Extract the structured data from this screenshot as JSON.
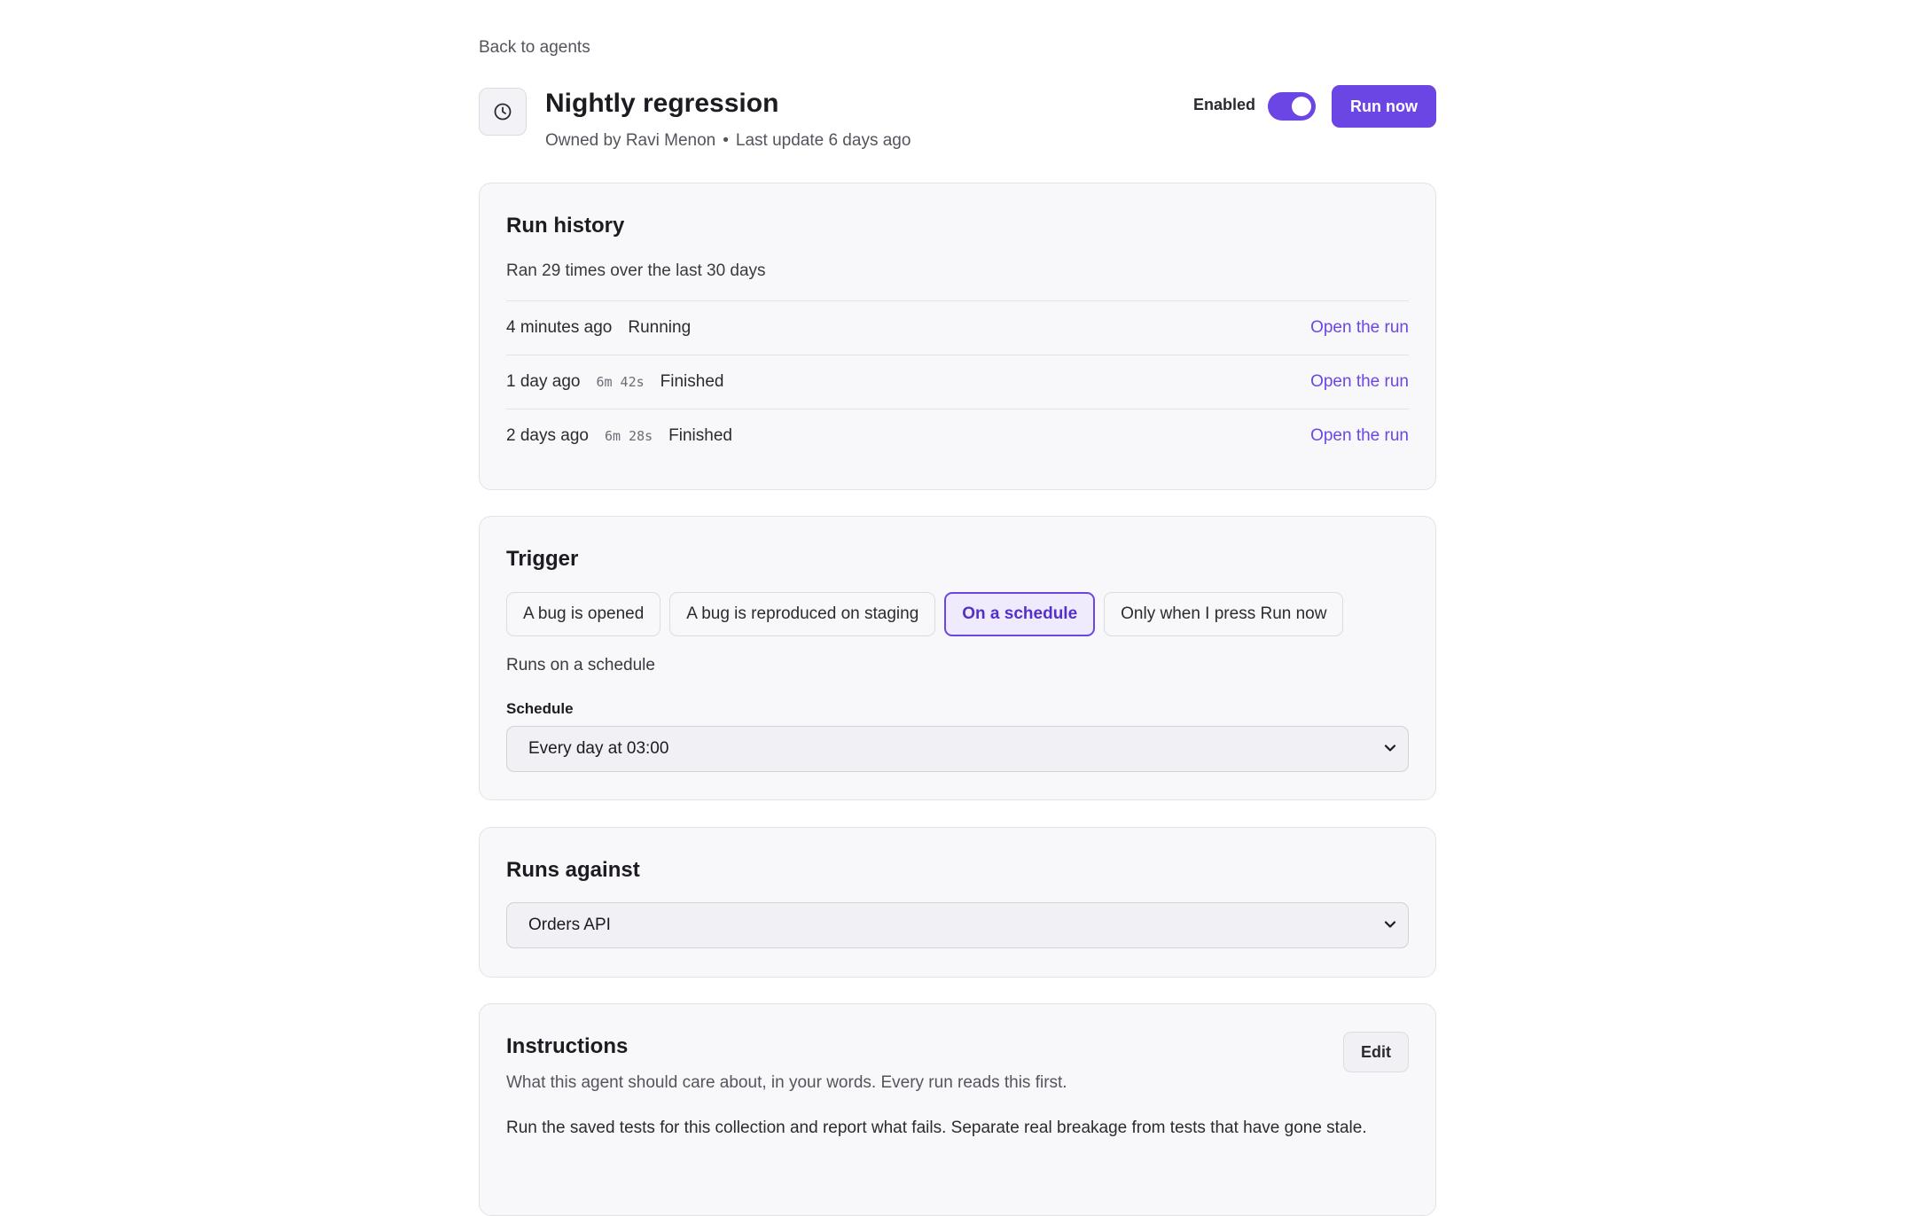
{
  "back_link": "Back to agents",
  "header": {
    "icon": "clock-icon",
    "title": "Nightly regression",
    "owner": "Owned by Ravi Menon",
    "separator": "•",
    "last_update": "Last update 6 days ago",
    "enabled_label": "Enabled",
    "enabled": true,
    "run_now_label": "Run now"
  },
  "colors": {
    "accent": "#6b46e5",
    "card_background": "#f8f8fa",
    "border": "#e3e2e8"
  },
  "run_history": {
    "title": "Run history",
    "summary": "Ran 29 times over the last 30 days",
    "runs": [
      {
        "when": "4 minutes ago",
        "duration": "",
        "status": "Running",
        "link": "Open the run"
      },
      {
        "when": "1 day ago",
        "duration": "6m 42s",
        "status": "Finished",
        "link": "Open the run"
      },
      {
        "when": "2 days ago",
        "duration": "6m 28s",
        "status": "Finished",
        "link": "Open the run"
      }
    ]
  },
  "trigger": {
    "title": "Trigger",
    "options": [
      {
        "label": "A bug is opened",
        "selected": false
      },
      {
        "label": "A bug is reproduced on staging",
        "selected": false
      },
      {
        "label": "On a schedule",
        "selected": true
      },
      {
        "label": "Only when I press Run now",
        "selected": false
      }
    ],
    "description": "Runs on a schedule",
    "schedule_label": "Schedule",
    "schedule_value": "Every day at 03:00"
  },
  "runs_against": {
    "title": "Runs against",
    "value": "Orders API"
  },
  "instructions": {
    "title": "Instructions",
    "edit_label": "Edit",
    "hint": "What this agent should care about, in your words. Every run reads this first.",
    "body": "Run the saved tests for this collection and report what fails. Separate real breakage from tests that have gone stale."
  }
}
